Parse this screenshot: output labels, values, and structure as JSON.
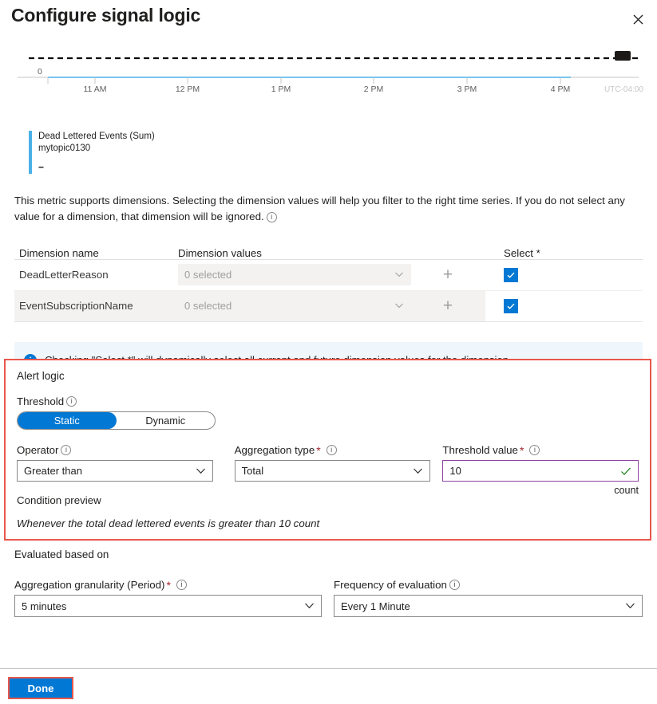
{
  "header": {
    "title": "Configure signal logic",
    "close_icon": "close-icon"
  },
  "chart": {
    "legend_metric": "Dead Lettered Events (Sum)",
    "legend_resource": "mytopic0130",
    "legend_value": "--",
    "y_tick": "0",
    "timezone": "UTC-04:00",
    "series_color": "#4ab0e8"
  },
  "chart_data": {
    "type": "line",
    "title": "Dead Lettered Events (Sum)",
    "series": [
      {
        "name": "mytopic0130",
        "values": [
          0,
          0,
          0,
          0,
          0,
          0,
          0
        ],
        "color": "#4ab0e8"
      }
    ],
    "x": [
      "11 AM",
      "12 PM",
      "1 PM",
      "2 PM",
      "3 PM",
      "4 PM"
    ],
    "categories": [
      "11 AM",
      "12 PM",
      "1 PM",
      "2 PM",
      "3 PM",
      "4 PM"
    ],
    "values": [
      0,
      0,
      0,
      0,
      0,
      0
    ],
    "xlabel": "",
    "ylabel": "",
    "ytick_labels": [
      "0"
    ],
    "ylim": [
      0,
      12
    ],
    "grid": false,
    "legend_position": "below",
    "annotations": [
      {
        "type": "threshold-line",
        "label": "10",
        "value": 10,
        "style": "dashed",
        "color": "#000000"
      }
    ],
    "timezone": "UTC-04:00"
  },
  "dimensions": {
    "description": "This metric supports dimensions. Selecting the dimension values will help you filter to the right time series. If you do not select any value for a dimension, that dimension will be ignored.",
    "columns": {
      "name": "Dimension name",
      "values": "Dimension values",
      "select": "Select *"
    },
    "rows": [
      {
        "name": "DeadLetterReason",
        "value": "0 selected",
        "add_label": "+",
        "checked": true
      },
      {
        "name": "EventSubscriptionName",
        "value": "0 selected",
        "add_label": "+",
        "checked": true
      }
    ]
  },
  "banner": {
    "icon": "info-icon",
    "text": "Checking \"Select *\" will dynamically select all current and future dimension values for the dimension."
  },
  "alert_logic": {
    "section_title": "Alert logic",
    "threshold_label": "Threshold",
    "threshold_options": [
      "Static",
      "Dynamic"
    ],
    "threshold_selected": "Static",
    "operator_label": "Operator",
    "operator_value": "Greater than",
    "aggregation_label": "Aggregation type",
    "aggregation_value": "Total",
    "threshold_value_label": "Threshold value",
    "threshold_value": "10",
    "threshold_unit": "count",
    "condition_preview_label": "Condition preview",
    "condition_preview_text": "Whenever the total dead lettered events is greater than 10 count",
    "required_mark": "*",
    "highlight_color": "#e8584c"
  },
  "evaluated": {
    "section_title": "Evaluated based on",
    "granularity_label": "Aggregation granularity (Period)",
    "granularity_value": "5 minutes",
    "frequency_label": "Frequency of evaluation",
    "frequency_value": "Every 1 Minute",
    "required_mark": "*"
  },
  "footer": {
    "done_label": "Done",
    "accent_color": "#0078d4"
  }
}
